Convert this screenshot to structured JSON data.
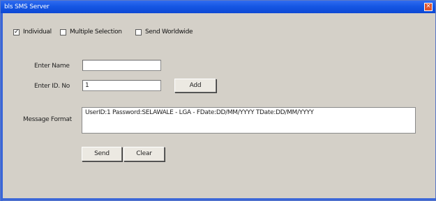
{
  "window": {
    "title": "bls SMS Server"
  },
  "options": {
    "individual": {
      "label": "Individual",
      "checked": "✓"
    },
    "multiple": {
      "label": "Multiple Selection"
    },
    "send_worldwide": {
      "label": "Send Worldwide"
    }
  },
  "form": {
    "enter_name_label": "Enter Name",
    "enter_name_value": "",
    "enter_id_label": "Enter ID. No",
    "enter_id_value": "1",
    "add_button": "Add",
    "message_format_label": "Message Format",
    "message_format_value": "UserID:1 Password:SELAWALE - LGA - FDate:DD/MM/YYYY TDate:DD/MM/YYYY"
  },
  "actions": {
    "send_button": "Send",
    "clear_button": "Clear"
  }
}
